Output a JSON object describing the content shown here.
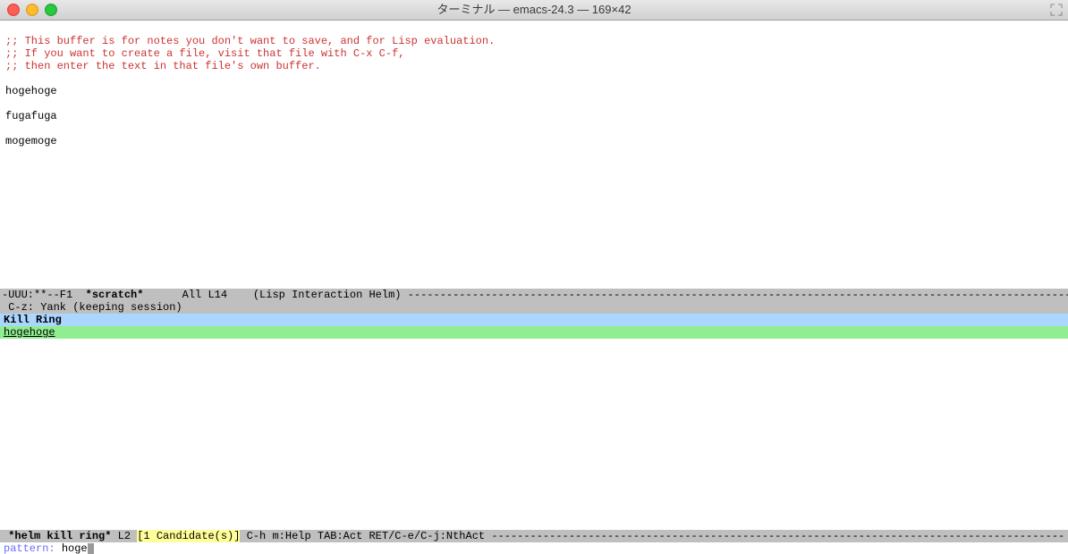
{
  "window": {
    "title": "ターミナル — emacs-24.3 — 169×42"
  },
  "scratch": {
    "comment1": ";; This buffer is for notes you don't want to save, and for Lisp evaluation.",
    "comment2": ";; If you want to create a file, visit that file with C-x C-f,",
    "comment3": ";; then enter the text in that file's own buffer.",
    "line1": "hogehoge",
    "line2": "fugafuga",
    "line3": "mogemoge"
  },
  "modeline_top": {
    "left": "-UUU:**--F1  ",
    "buffer": "*scratch*",
    "mid": "      All L14    (Lisp Interaction Helm) ",
    "fill": "-------------------------------------------------------------------------------------------------------"
  },
  "helpline": {
    "text": " C-z: Yank (keeping session)"
  },
  "helm": {
    "header": "Kill Ring",
    "candidate": "hogehoge"
  },
  "modeline_bottom": {
    "pre": " ",
    "buffer": "*helm kill ring*",
    "line": " L2 ",
    "cand": "[1 Candidate(s)]",
    "post": " C-h m:Help TAB:Act RET/C-e/C-j:NthAct ",
    "fill": "-----------------------------------------------------------------------------------------"
  },
  "minibuffer": {
    "label": "pattern: ",
    "value": "hoge"
  }
}
